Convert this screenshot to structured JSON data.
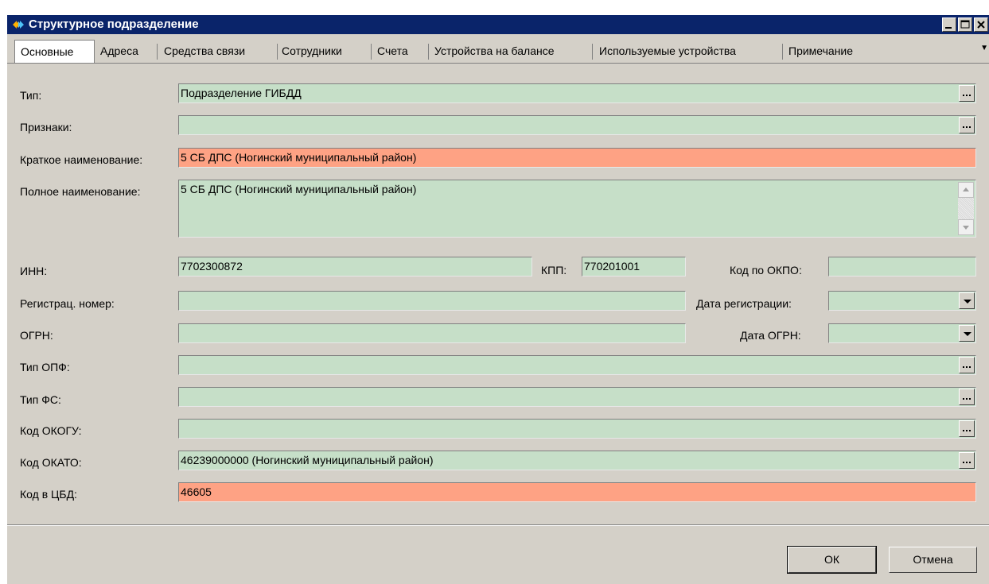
{
  "window": {
    "title": "Структурное подразделение"
  },
  "tabs": [
    {
      "label": "Основные",
      "active": true
    },
    {
      "label": "Адреса"
    },
    {
      "label": "Средства связи"
    },
    {
      "label": "Сотрудники"
    },
    {
      "label": "Счета"
    },
    {
      "label": "Устройства на балансе"
    },
    {
      "label": "Используемые устройства"
    },
    {
      "label": "Примечание"
    }
  ],
  "form": {
    "type": {
      "label": "Тип:",
      "value": "Подразделение ГИБДД"
    },
    "signs": {
      "label": "Признаки:",
      "value": ""
    },
    "short_name": {
      "label": "Краткое наименование:",
      "value": "5 СБ ДПС (Ногинский муниципальный район)"
    },
    "full_name": {
      "label": "Полное наименование:",
      "value": "5 СБ ДПС (Ногинский муниципальный район)"
    },
    "inn": {
      "label": "ИНН:",
      "value": "7702300872"
    },
    "kpp": {
      "label": "КПП:",
      "value": "770201001"
    },
    "okpo": {
      "label": "Код по ОКПО:",
      "value": ""
    },
    "reg_number": {
      "label": "Регистрац. номер:",
      "value": ""
    },
    "reg_date": {
      "label": "Дата регистрации:",
      "value": ""
    },
    "ogrn": {
      "label": "ОГРН:",
      "value": ""
    },
    "ogrn_date": {
      "label": "Дата ОГРН:",
      "value": ""
    },
    "opf_type": {
      "label": "Тип ОПФ:",
      "value": ""
    },
    "fs_type": {
      "label": "Тип ФС:",
      "value": ""
    },
    "okogu": {
      "label": "Код ОКОГУ:",
      "value": ""
    },
    "okato": {
      "label": "Код ОКАТО:",
      "value": "46239000000 (Ногинский муниципальный район)"
    },
    "cbd_code": {
      "label": "Код в ЦБД:",
      "value": "46605"
    }
  },
  "buttons": {
    "ok": "ОК",
    "cancel": "Отмена"
  },
  "colors": {
    "field": "#c6dfc8",
    "required_field": "#fea284",
    "titlebar": "#0a246a",
    "window_bg": "#d4d0c8"
  }
}
